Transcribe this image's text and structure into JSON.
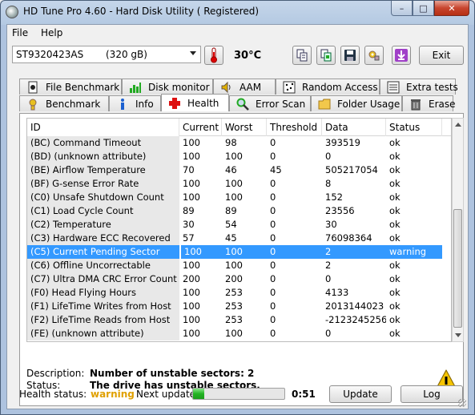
{
  "window": {
    "title": "HD Tune Pro 4.60 - Hard Disk Utility ( Registered)",
    "minimize_label": "–",
    "maximize_label": "□",
    "close_label": "✕"
  },
  "menu": {
    "file": "File",
    "help": "Help"
  },
  "toolbar": {
    "drive_name": "ST9320423AS",
    "drive_size": "(320 gB)",
    "temperature": "30°C",
    "exit_label": "Exit",
    "icons": [
      "copy-icon",
      "copy-all-icon",
      "save-icon",
      "options-icon",
      "download-icon"
    ]
  },
  "tabs": {
    "row1": [
      {
        "label": "File Benchmark",
        "icon": "file-benchmark-icon"
      },
      {
        "label": "Disk monitor",
        "icon": "disk-monitor-icon"
      },
      {
        "label": "AAM",
        "icon": "speaker-icon"
      },
      {
        "label": "Random Access",
        "icon": "random-access-icon"
      },
      {
        "label": "Extra tests",
        "icon": "extra-tests-icon"
      }
    ],
    "row2": [
      {
        "label": "Benchmark",
        "icon": "benchmark-icon"
      },
      {
        "label": "Info",
        "icon": "info-icon"
      },
      {
        "label": "Health",
        "icon": "health-cross-icon"
      },
      {
        "label": "Error Scan",
        "icon": "magnifier-icon"
      },
      {
        "label": "Folder Usage",
        "icon": "folder-icon"
      },
      {
        "label": "Erase",
        "icon": "trash-icon"
      }
    ],
    "active": "Health"
  },
  "grid": {
    "columns": [
      "ID",
      "Current",
      "Worst",
      "Threshold",
      "Data",
      "Status"
    ],
    "rows": [
      [
        "(BC) Command Timeout",
        "100",
        "98",
        "0",
        "393519",
        "ok"
      ],
      [
        "(BD) (unknown attribute)",
        "100",
        "100",
        "0",
        "0",
        "ok"
      ],
      [
        "(BE) Airflow Temperature",
        "70",
        "46",
        "45",
        "505217054",
        "ok"
      ],
      [
        "(BF) G-sense Error Rate",
        "100",
        "100",
        "0",
        "8",
        "ok"
      ],
      [
        "(C0) Unsafe Shutdown Count",
        "100",
        "100",
        "0",
        "152",
        "ok"
      ],
      [
        "(C1) Load Cycle Count",
        "89",
        "89",
        "0",
        "23556",
        "ok"
      ],
      [
        "(C2) Temperature",
        "30",
        "54",
        "0",
        "30",
        "ok"
      ],
      [
        "(C3) Hardware ECC Recovered",
        "57",
        "45",
        "0",
        "76098364",
        "ok"
      ],
      [
        "(C5) Current Pending Sector",
        "100",
        "100",
        "0",
        "2",
        "warning"
      ],
      [
        "(C6) Offline Uncorrectable",
        "100",
        "100",
        "0",
        "2",
        "ok"
      ],
      [
        "(C7) Ultra DMA CRC Error Count",
        "200",
        "200",
        "0",
        "0",
        "ok"
      ],
      [
        "(F0) Head Flying Hours",
        "100",
        "253",
        "0",
        "4133",
        "ok"
      ],
      [
        "(F1) LifeTime Writes from Host",
        "100",
        "253",
        "0",
        "2013144023",
        "ok"
      ],
      [
        "(F2) LifeTime Reads from Host",
        "100",
        "253",
        "0",
        "-2123245256",
        "ok"
      ],
      [
        "(FE) (unknown attribute)",
        "100",
        "100",
        "0",
        "0",
        "ok"
      ]
    ],
    "selected_index": 8
  },
  "details": {
    "description_label": "Description:",
    "description_value": "Number of unstable sectors: 2",
    "status_label": "Status:",
    "status_value": "The drive has unstable sectors."
  },
  "footer": {
    "health_label": "Health status:",
    "health_value": "warning",
    "next_update_label": "Next update:",
    "next_update_progress": 0.12,
    "countdown": "0:51",
    "update_label": "Update",
    "log_label": "Log"
  },
  "colors": {
    "selection": "#3399ff",
    "warning": "#e0a000",
    "progress": "#22b322"
  }
}
